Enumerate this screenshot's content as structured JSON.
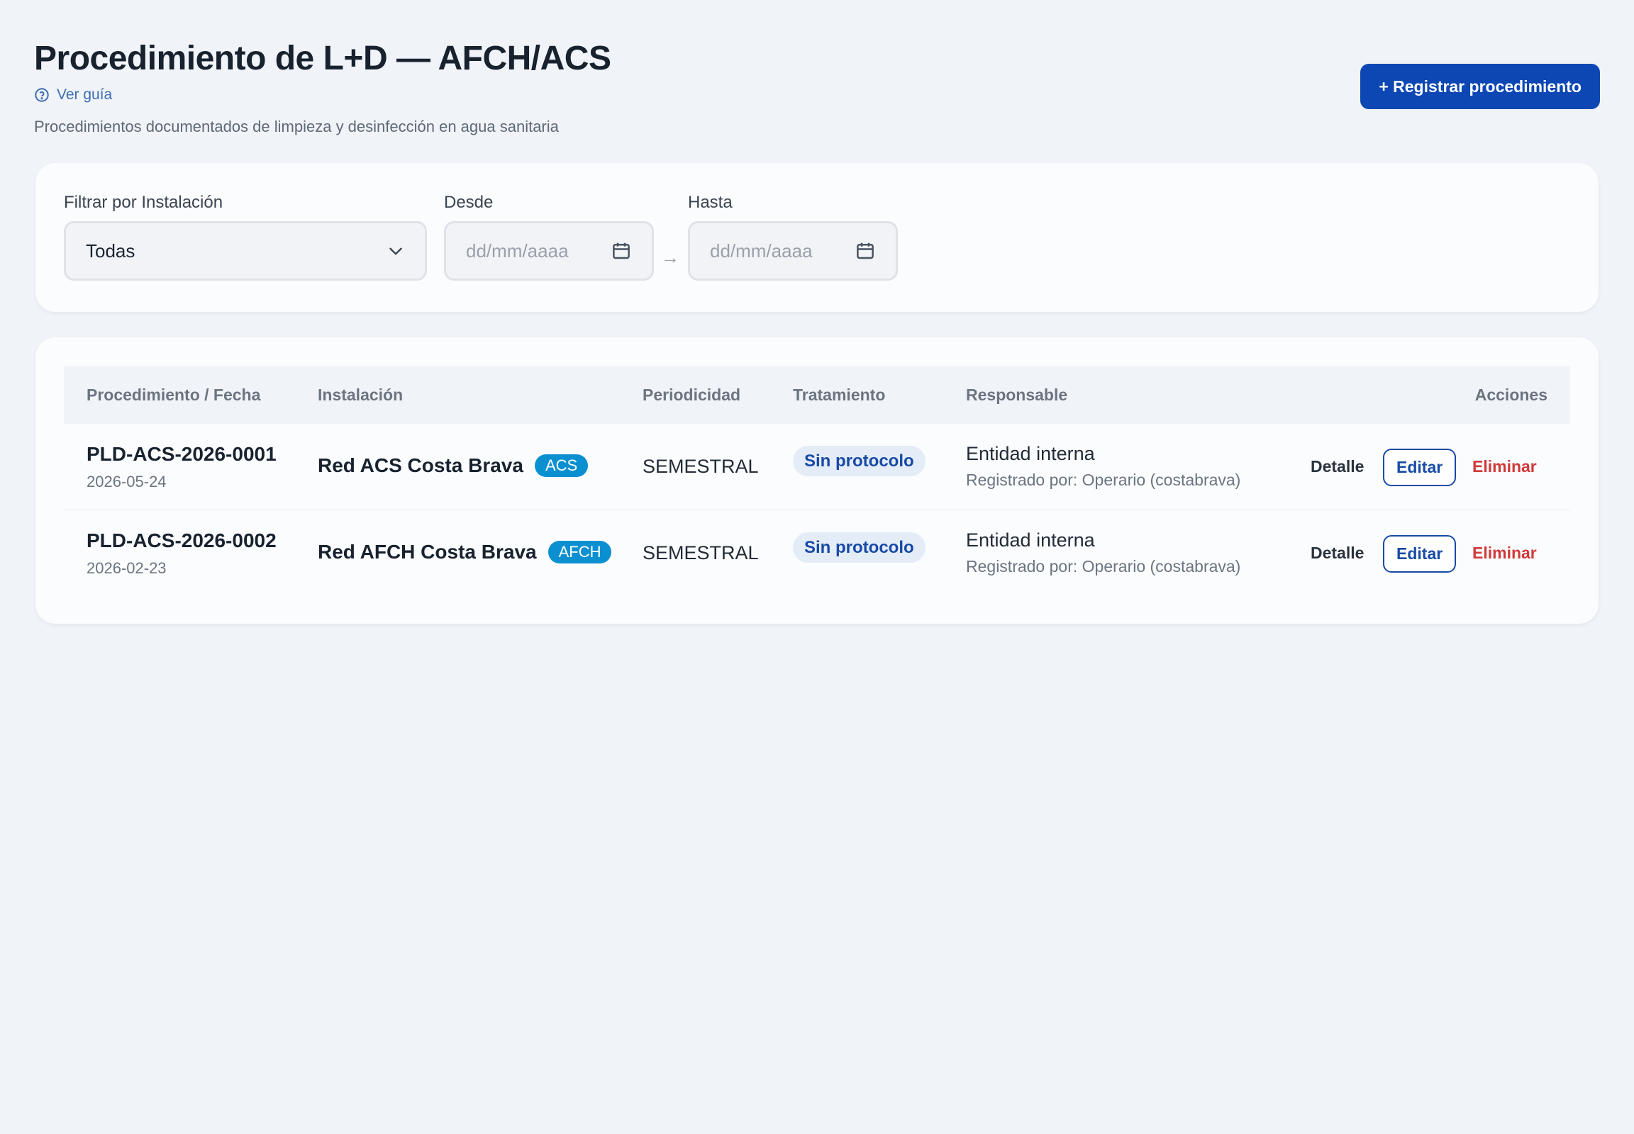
{
  "header": {
    "title": "Procedimiento de L+D — AFCH/ACS",
    "guide_link": "Ver guía",
    "subtitle": "Procedimientos documentados de limpieza y desinfección en agua sanitaria",
    "primary_button": "+ Registrar procedimiento"
  },
  "filters": {
    "installation_label": "Filtrar por Instalación",
    "installation_value": "Todas",
    "from_label": "Desde",
    "from_placeholder": "dd/mm/aaaa",
    "to_label": "Hasta",
    "to_placeholder": "dd/mm/aaaa",
    "range_arrow": "→"
  },
  "table": {
    "headers": [
      "Procedimiento / Fecha",
      "Instalación",
      "Periodicidad",
      "Tratamiento",
      "Responsable",
      "Acciones"
    ],
    "rows": [
      {
        "id": "PLD-ACS-2026-0001",
        "date": "2026-05-24",
        "installation": "Red ACS Costa Brava",
        "tag": "ACS",
        "periodicity": "SEMESTRAL",
        "treatment": "Sin protocolo",
        "responsible": "Entidad interna",
        "registered_by": "Registrado por: Operario (costabrava)",
        "actions": {
          "detail": "Detalle",
          "edit": "Editar",
          "delete": "Eliminar"
        }
      },
      {
        "id": "PLD-ACS-2026-0002",
        "date": "2026-02-23",
        "installation": "Red AFCH Costa Brava",
        "tag": "AFCH",
        "periodicity": "SEMESTRAL",
        "treatment": "Sin protocolo",
        "responsible": "Entidad interna",
        "registered_by": "Registrado por: Operario (costabrava)",
        "actions": {
          "detail": "Detalle",
          "edit": "Editar",
          "delete": "Eliminar"
        }
      }
    ]
  },
  "icons": {
    "guide": "help-circle-icon",
    "dropdown": "chevron-down-icon",
    "calendar": "calendar-icon"
  },
  "colors": {
    "primary": "#0c47b4",
    "tag": "#0a90d0",
    "delete": "#d03939",
    "background": "#f0f3f7"
  }
}
